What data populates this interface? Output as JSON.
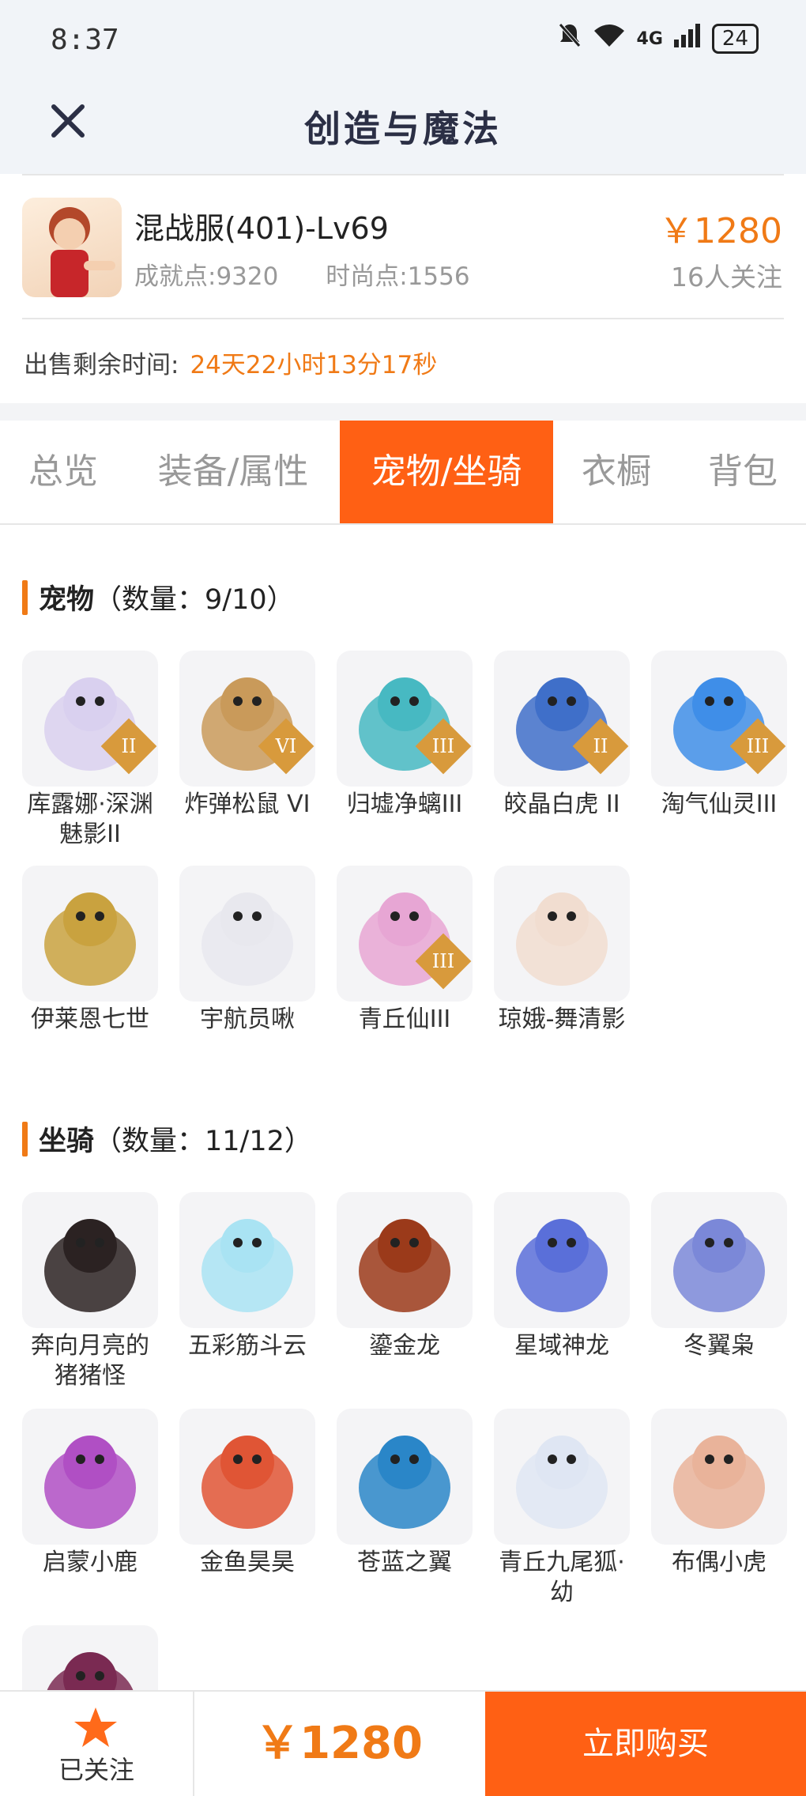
{
  "status": {
    "time": "8:37",
    "signal": "4G",
    "battery": "24"
  },
  "nav": {
    "title": "创造与魔法"
  },
  "listing": {
    "server_name": "混战服(401)-Lv69",
    "achievement": "成就点:9320",
    "fashion": "时尚点:1556",
    "price": "￥1280",
    "watchers": "16人关注",
    "remaining_label": "出售剩余时间:",
    "remaining_value": "24天22小时13分17秒"
  },
  "tabs": [
    {
      "label": "总览"
    },
    {
      "label": "装备/属性"
    },
    {
      "label": "宠物/坐骑"
    },
    {
      "label": "衣橱"
    },
    {
      "label": "背包"
    }
  ],
  "pets": {
    "title": "宠物",
    "count": "（数量：9/10）",
    "items": [
      {
        "label": "库露娜·深渊魅影II",
        "icon": "pet-kuluna-icon",
        "badge": "II",
        "color": "#d9d0ef"
      },
      {
        "label": "炸弹松鼠 VI",
        "icon": "pet-bomb-squirrel-icon",
        "badge": "VI",
        "color": "#c99a5a"
      },
      {
        "label": "归墟净螭III",
        "icon": "pet-dragon-cyan-icon",
        "badge": "III",
        "color": "#47b9c2"
      },
      {
        "label": "皎晶白虎 II",
        "icon": "pet-white-tiger-icon",
        "badge": "II",
        "color": "#3f6fc9"
      },
      {
        "label": "淘气仙灵III",
        "icon": "pet-blue-dog-icon",
        "badge": "III",
        "color": "#3f8ee8"
      },
      {
        "label": "伊莱恩七世",
        "icon": "pet-queen-icon",
        "badge": "",
        "color": "#c9a23f"
      },
      {
        "label": "宇航员啾",
        "icon": "pet-astronaut-icon",
        "badge": "",
        "color": "#e8e8ee"
      },
      {
        "label": "青丘仙III",
        "icon": "pet-fox-fairy-icon",
        "badge": "III",
        "color": "#e7a6d4"
      },
      {
        "label": "琼娥-舞清影",
        "icon": "pet-dancer-icon",
        "badge": "",
        "color": "#f1ddd0"
      }
    ]
  },
  "mounts": {
    "title": "坐骑",
    "count": "（数量：11/12）",
    "items": [
      {
        "label": "奔向月亮的猪猪怪",
        "icon": "mount-pig-icon",
        "color": "#2b2222"
      },
      {
        "label": "五彩筋斗云",
        "icon": "mount-cloud-icon",
        "color": "#a9e3f3"
      },
      {
        "label": "鎏金龙",
        "icon": "mount-gold-dragon-icon",
        "color": "#9b3a1a"
      },
      {
        "label": "星域神龙",
        "icon": "mount-star-dragon-icon",
        "color": "#5a6fd9"
      },
      {
        "label": "冬翼枭",
        "icon": "mount-owl-icon",
        "color": "#7b88d8"
      },
      {
        "label": "启蒙小鹿",
        "icon": "mount-deer-icon",
        "color": "#b04fc4"
      },
      {
        "label": "金鱼昊昊",
        "icon": "mount-goldfish-icon",
        "color": "#e05535"
      },
      {
        "label": "苍蓝之翼",
        "icon": "mount-blue-wing-icon",
        "color": "#2a86c8"
      },
      {
        "label": "青丘九尾狐·幼",
        "icon": "mount-nine-tail-fox-icon",
        "color": "#dfe6f3"
      },
      {
        "label": "布偶小虎",
        "icon": "mount-toy-tiger-icon",
        "color": "#e9b39a"
      },
      {
        "label": "",
        "icon": "mount-dark-dragon-icon",
        "color": "#7a2a52"
      }
    ]
  },
  "bottom": {
    "watch_label": "已关注",
    "price": "￥1280",
    "buy_label": "立即购买"
  }
}
